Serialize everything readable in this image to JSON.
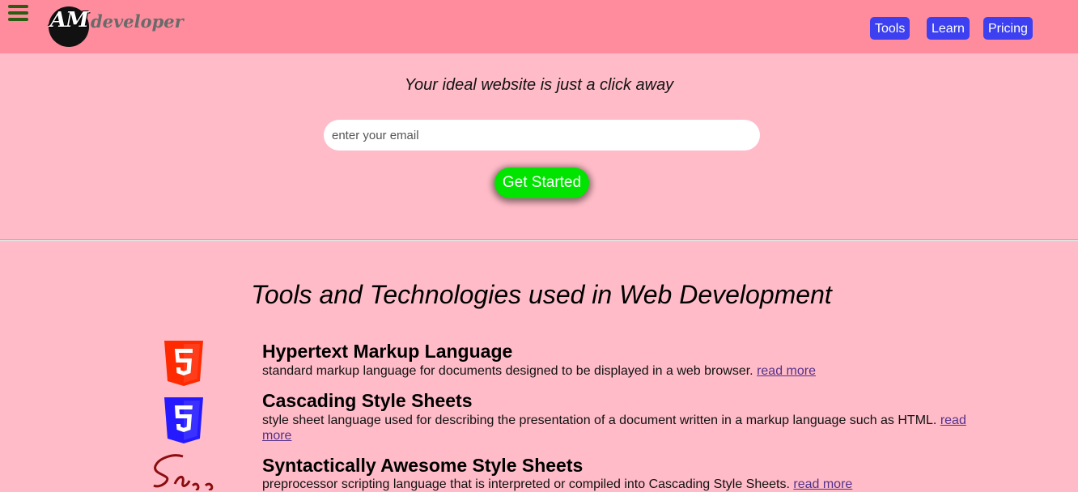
{
  "header": {
    "logo_text_am": "AM",
    "logo_text_dev": "developer",
    "nav": [
      {
        "label": "Tools"
      },
      {
        "label": "Learn"
      },
      {
        "label": "Pricing"
      }
    ]
  },
  "hero": {
    "tagline": "Your ideal website is just a click away",
    "email_placeholder": "enter your email",
    "cta_label": "Get Started"
  },
  "tools": {
    "title": "Tools and Technologies used in Web Development",
    "items": [
      {
        "title": "Hypertext Markup Language",
        "description": "standard markup language for documents designed to be displayed in a web browser.",
        "link": "read more",
        "icon": "html5-icon",
        "icon_label": "5",
        "color": "#ff2a00"
      },
      {
        "title": "Cascading Style Sheets",
        "description": "style sheet language used for describing the presentation of a document written in a markup language such as HTML.",
        "link": "read more",
        "icon": "css3-icon",
        "icon_label": "3",
        "color": "#2419ff"
      },
      {
        "title": "Syntactically Awesome Style Sheets",
        "description": "preprocessor scripting language that is interpreted or compiled into Cascading Style Sheets.",
        "link": "read more",
        "icon": "sass-icon",
        "icon_label": "Sass",
        "color": "#8b0d10"
      }
    ]
  },
  "colors": {
    "background": "#ffbcc8",
    "header": "#ff8c9c",
    "nav_button": "#3c40f0",
    "cta": "#00e400",
    "hamburger": "#2c5b12"
  }
}
